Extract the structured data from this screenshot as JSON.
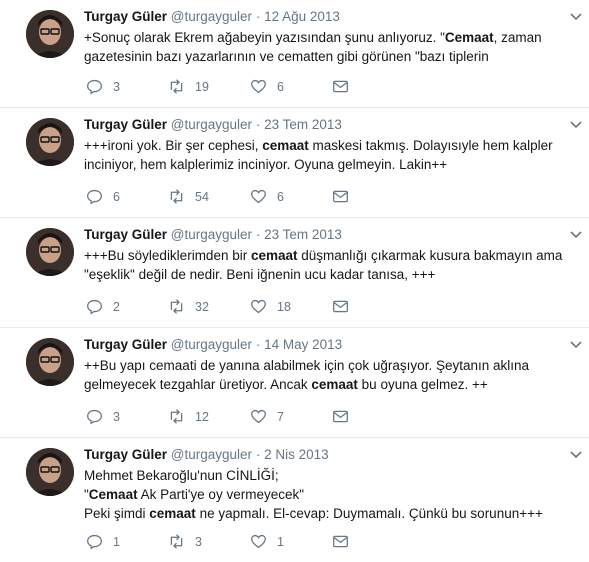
{
  "tweets": [
    {
      "name": "Turgay Güler",
      "handle": "@turgayguler",
      "date": "12 Ağu 2013",
      "lines": [
        "+Sonuç olarak Ekrem ağabeyin yazısından şunu anlıyoruz. \"Cemaat, zaman",
        "gazetesinin bazı yazarlarının ve cematten gibi görünen \"bazı tiplerin"
      ],
      "replies": "3",
      "retweets": "19",
      "likes": "6"
    },
    {
      "name": "Turgay Güler",
      "handle": "@turgayguler",
      "date": "23 Tem 2013",
      "lines": [
        "+++ironi yok. Bir şer cephesi, cemaat maskesi takmış. Dolayısıyle hem kalpler",
        "inciniyor, hem kalplerimiz inciniyor. Oyuna gelmeyin. Lakin++"
      ],
      "replies": "6",
      "retweets": "54",
      "likes": "6"
    },
    {
      "name": "Turgay Güler",
      "handle": "@turgayguler",
      "date": "23 Tem 2013",
      "lines": [
        "+++Bu söylediklerimden bir cemaat düşmanlığı çıkarmak kusura bakmayın ama",
        "\"eşeklik\" değil de nedir. Beni iğnenin ucu kadar tanısa, +++"
      ],
      "replies": "2",
      "retweets": "32",
      "likes": "18"
    },
    {
      "name": "Turgay Güler",
      "handle": "@turgayguler",
      "date": "14 May 2013",
      "lines": [
        "++Bu yapı cemaati de yanına alabilmek için çok uğraşıyor. Şeytanın aklına",
        "gelmeyecek tezgahlar üretiyor. Ancak cemaat bu oyuna gelmez. ++"
      ],
      "replies": "3",
      "retweets": "12",
      "likes": "7"
    },
    {
      "name": "Turgay Güler",
      "handle": "@turgayguler",
      "date": "2 Nis 2013",
      "lines": [
        "Mehmet Bekaroğlu'nun CİNLİĞİ;",
        "\"Cemaat Ak Parti'ye oy vermeyecek\"",
        "Peki şimdi cemaat ne yapmalı. El-cevap: Duymamalı. Çünkü bu sorunun+++"
      ],
      "replies": "1",
      "retweets": "3",
      "likes": "1"
    }
  ],
  "ui": {
    "separator": "·",
    "accent": "#c8102e",
    "icons": [
      "reply-icon",
      "retweet-icon",
      "like-icon",
      "message-icon",
      "chevron-down-icon"
    ]
  }
}
